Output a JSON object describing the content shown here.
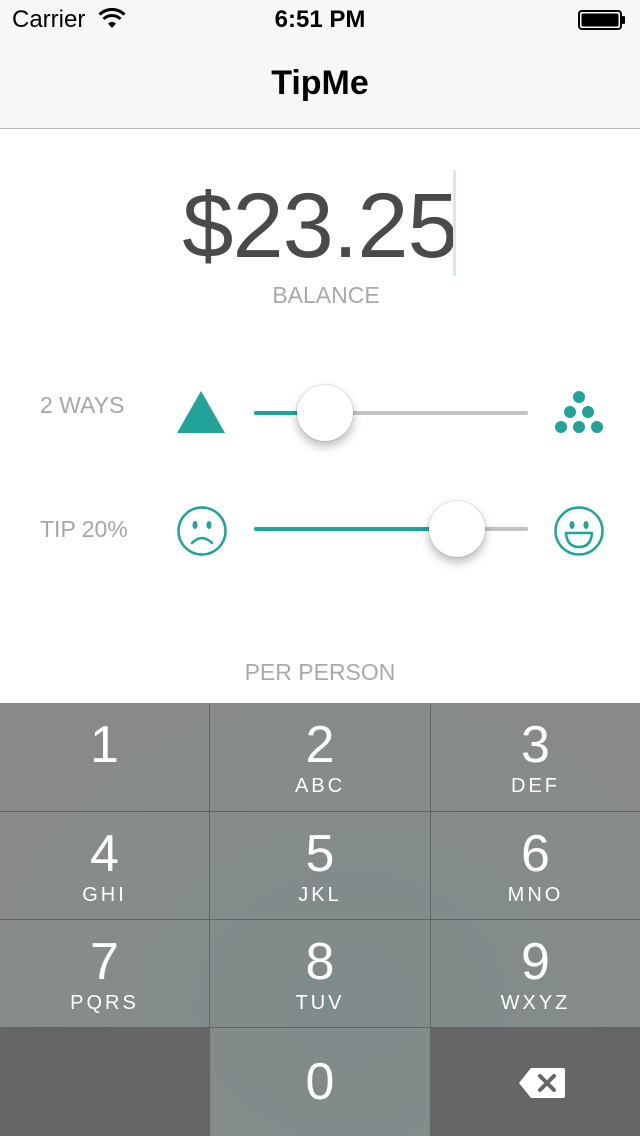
{
  "status_bar": {
    "carrier": "Carrier",
    "time": "6:51 PM"
  },
  "nav": {
    "title": "TipMe"
  },
  "balance": {
    "amount": "$23.25",
    "label": "BALANCE"
  },
  "split": {
    "label": "2 WAYS",
    "value": 0.26,
    "min_icon": "triangle-icon",
    "max_icon": "people-dots-icon"
  },
  "tip": {
    "label": "TIP 20%",
    "value": 0.74,
    "min_icon": "sad-face-icon",
    "max_icon": "happy-face-icon"
  },
  "per_person": {
    "label": "PER PERSON"
  },
  "accent_color": "#22a39a",
  "keypad": {
    "keys": [
      {
        "digit": "1",
        "letters": ""
      },
      {
        "digit": "2",
        "letters": "ABC"
      },
      {
        "digit": "3",
        "letters": "DEF"
      },
      {
        "digit": "4",
        "letters": "GHI"
      },
      {
        "digit": "5",
        "letters": "JKL"
      },
      {
        "digit": "6",
        "letters": "MNO"
      },
      {
        "digit": "7",
        "letters": "PQRS"
      },
      {
        "digit": "8",
        "letters": "TUV"
      },
      {
        "digit": "9",
        "letters": "WXYZ"
      },
      {
        "digit": "0",
        "letters": ""
      }
    ],
    "delete_icon": "backspace-icon"
  }
}
